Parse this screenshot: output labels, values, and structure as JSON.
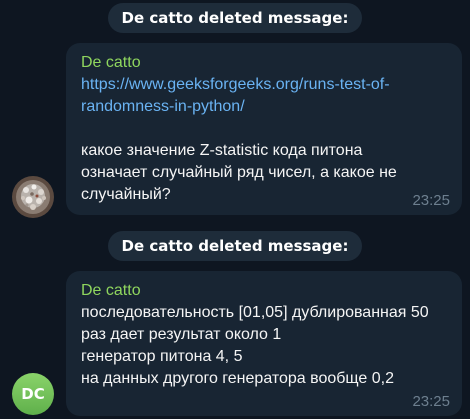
{
  "messages": [
    {
      "service": "De catto deleted message:",
      "sender": "De catto",
      "link": "https://www.geeksforgeeks.org/runs-test-of-\nrandomness-in-python/",
      "text": "какое значение Z-statistic кода питона\nозначает случайный ряд чисел, а какое не\nслучайный?",
      "time": "23:25",
      "avatar": "cat-photo"
    },
    {
      "service": "De catto deleted message:",
      "sender": "De catto",
      "text": "последовательность [01,05] дублированная 50\nраз дает результат около 1\nгенератор питона 4, 5\nна данных другого генератора вообще 0,2",
      "time": "23:25",
      "avatar_initials": "DC"
    }
  ],
  "colors": {
    "background": "#0e1621",
    "bubble": "#182533",
    "sender": "#8fd65e",
    "link": "#6ab3f3",
    "time": "#6d7f8f",
    "service_pill": "#1e2c3a",
    "avatar": "#6bbf54"
  }
}
